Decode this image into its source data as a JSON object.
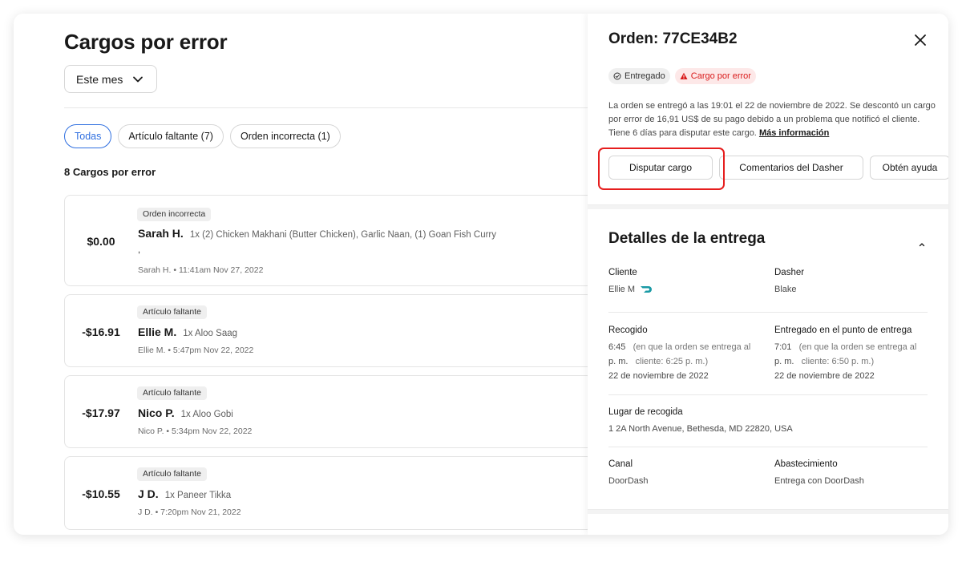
{
  "left": {
    "title": "Cargos por error",
    "month_select": "Este mes",
    "filters": [
      "Todas",
      "Artículo faltante (7)",
      "Orden incorrecta (1)"
    ],
    "count_label": "8 Cargos por error",
    "cards": [
      {
        "amount": "$0.00",
        "tag": "Orden incorrecta",
        "name": "Sarah H.",
        "items": "1x (2) Chicken Makhani (Butter Chicken), Garlic Naan, (1) Goan Fish Curry",
        "extra": ",",
        "meta": "Sarah H. • 11:41am Nov 27, 2022"
      },
      {
        "amount": "-$16.91",
        "tag": "Artículo faltante",
        "name": "Ellie M.",
        "items": "1x Aloo Saag",
        "meta": "Ellie M. • 5:47pm Nov 22, 2022"
      },
      {
        "amount": "-$17.97",
        "tag": "Artículo faltante",
        "name": "Nico P.",
        "items": "1x Aloo Gobi",
        "meta": "Nico P. • 5:34pm Nov 22, 2022"
      },
      {
        "amount": "-$10.55",
        "tag": "Artículo faltante",
        "name": "J D.",
        "items": "1x Paneer Tikka",
        "meta": "J D. • 7:20pm Nov 21, 2022"
      }
    ]
  },
  "panel": {
    "order_title": "Orden: 77CE34B2",
    "badge_status": "Entregado",
    "badge_error": "Cargo por error",
    "description": "La orden se entregó a las 19:01 el 22 de noviembre de 2022. Se descontó un cargo por error de 16,91 US$ de su pago debido a un problema que notificó el cliente. Tiene 6 días para disputar este cargo.",
    "more_link": "Más información",
    "btn_dispute": "Disputar cargo",
    "btn_feedback": "Comentarios del Dasher",
    "btn_help": "Obtén ayuda",
    "details_title": "Detalles de la entrega",
    "customer_label": "Cliente",
    "customer_value": "Ellie M",
    "dasher_label": "Dasher",
    "dasher_value": "Blake",
    "pickup_label": "Recogido",
    "pickup_time": "6:45",
    "pickup_ampm": "p. m.",
    "pickup_note_1": "(en que la orden se entrega al",
    "pickup_note_2": "cliente: 6:25 p. m.)",
    "pickup_date": "22 de noviembre de 2022",
    "delivered_label": "Entregado en el punto de entrega",
    "delivered_time": "7:01",
    "delivered_ampm": "p. m.",
    "delivered_note_1": "(en que la orden se entrega al",
    "delivered_note_2": "cliente: 6:50 p. m.)",
    "delivered_date": "22 de noviembre de 2022",
    "pickup_place_label": "Lugar de recogida",
    "pickup_place_value": "1 2A North Avenue, Bethesda, MD 22820, USA",
    "channel_label": "Canal",
    "channel_value": "DoorDash",
    "fulfillment_label": "Abastecimiento",
    "fulfillment_value": "Entrega con DoorDash"
  },
  "colors": {
    "accent": "#2f6fe0",
    "error": "#d91a1a",
    "highlight": "#e61e1e",
    "doordash": "#1a9aa5"
  },
  "icons": [
    "chevron-down-icon",
    "close-icon",
    "check-circle-icon",
    "warning-icon",
    "doordash-logo-icon",
    "chevron-up-icon"
  ]
}
